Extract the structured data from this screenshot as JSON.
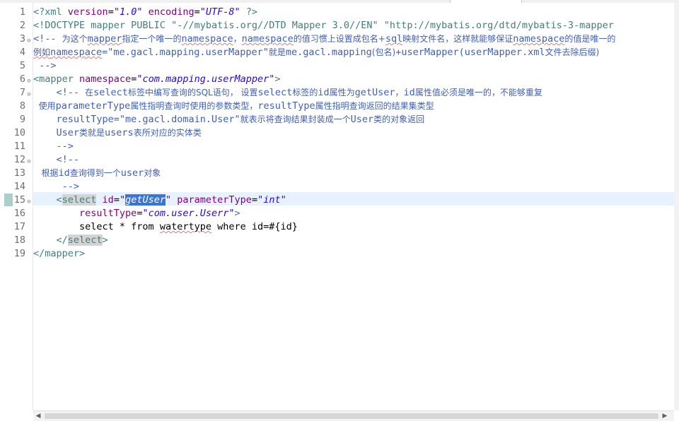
{
  "editor": {
    "line_numbers": [
      "1",
      "2",
      "3",
      "4",
      "5",
      "6",
      "7",
      "8",
      "9",
      "10",
      "11",
      "12",
      "13",
      "14",
      "15",
      "16",
      "17",
      "18",
      "19"
    ],
    "fold_icon": "⊖",
    "lines": {
      "l1": {
        "p1": "<?xml ",
        "p2": "version",
        "p3": "=",
        "p4": "\"1.0\"",
        "p5": " encoding",
        "p6": "=",
        "p7": "\"UTF-8\"",
        "p8": " ?>"
      },
      "l2": {
        "p1": "<!DOCTYPE mapper PUBLIC ",
        "p2": "\"-//mybatis.org//DTD Mapper 3.0//EN\" \"http://mybatis.org/dtd/mybatis-3-mapper"
      },
      "l3": {
        "p1": "<!-- ",
        "p2": "为这个",
        "p3": "mapper",
        "p4": "指定一个唯一的",
        "p5": "namespace",
        "p6": "，",
        "p7": "namespace",
        "p8": "的值习惯上设置成包名+",
        "p9": "sql",
        "p10": "映射文件名，这样就能够保证",
        "p11": "namespace",
        "p12": "的值是唯一的"
      },
      "l4": {
        "p1": "例如",
        "p2": "namespace",
        "p3": "=\"me.gacl.mapping.userMapper\"",
        "p4": "就是",
        "p5": "me.gacl.mapping",
        "p6": "(包名)",
        "p7": "+userMapper(userMapper.xml",
        "p8": "文件去除后缀)"
      },
      "l5": {
        "p1": " -->"
      },
      "l6": {
        "p1": "<mapper ",
        "p2": "namespace",
        "p3": "=",
        "p4": "\"com.mapping.userMapper\"",
        "p5": ">"
      },
      "l7": {
        "p1": "    <!-- ",
        "p2": "在",
        "p3": "select",
        "p4": "标签中编写查询的",
        "p5": "SQL",
        "p6": "语句， 设置",
        "p7": "select",
        "p8": "标签的",
        "p9": "id",
        "p10": "属性为",
        "p11": "getUser",
        "p12": "，",
        "p13": "id",
        "p14": "属性值必须是唯一的，不能够重复"
      },
      "l8": {
        "p1": "  使用",
        "p2": "parameterType",
        "p3": "属性指明查询时使用的参数类型，",
        "p4": "resultType",
        "p5": "属性指明查询返回的结果集类型"
      },
      "l9": {
        "p1": "    resultType=\"me.gacl.domain.User\"",
        "p2": "就表示将查询结果封装成一个",
        "p3": "User",
        "p4": "类的对象返回"
      },
      "l10": {
        "p1": "    User",
        "p2": "类就是",
        "p3": "users",
        "p4": "表所对应的实体类"
      },
      "l11": {
        "p1": "    -->"
      },
      "l12": {
        "p1": "    <!--"
      },
      "l13": {
        "p1": "   根据",
        "p2": "id",
        "p3": "查询得到一个",
        "p4": "user",
        "p5": "对象"
      },
      "l14": {
        "p1": "     -->"
      },
      "l15": {
        "p1": "    <",
        "p2": "select",
        "p3": " id",
        "p4": "=",
        "p5": "\"",
        "p6": "getUser",
        "p7": "\"",
        "p8": " parameterType",
        "p9": "=",
        "p10": "\"int\""
      },
      "l16": {
        "p1": "        resultType",
        "p2": "=",
        "p3": "\"com.user.Userr\"",
        "p4": ">"
      },
      "l17": {
        "p1": "        select * from ",
        "p2": "watertype",
        "p3": " where id=#{id}"
      },
      "l18": {
        "p1": "    </",
        "p2": "select",
        "p3": ">"
      },
      "l19": {
        "p1": "</mapper>"
      }
    }
  },
  "colors": {
    "tag": "#3f7f7f",
    "attribute": "#7f007f",
    "value": "#2a00ff",
    "comment": "#3f5fbf",
    "current_line": "#e8f2fe",
    "selection": "#3875d7"
  },
  "scrollbar": {
    "left_arrow": "◀",
    "right_arrow": "▶"
  }
}
